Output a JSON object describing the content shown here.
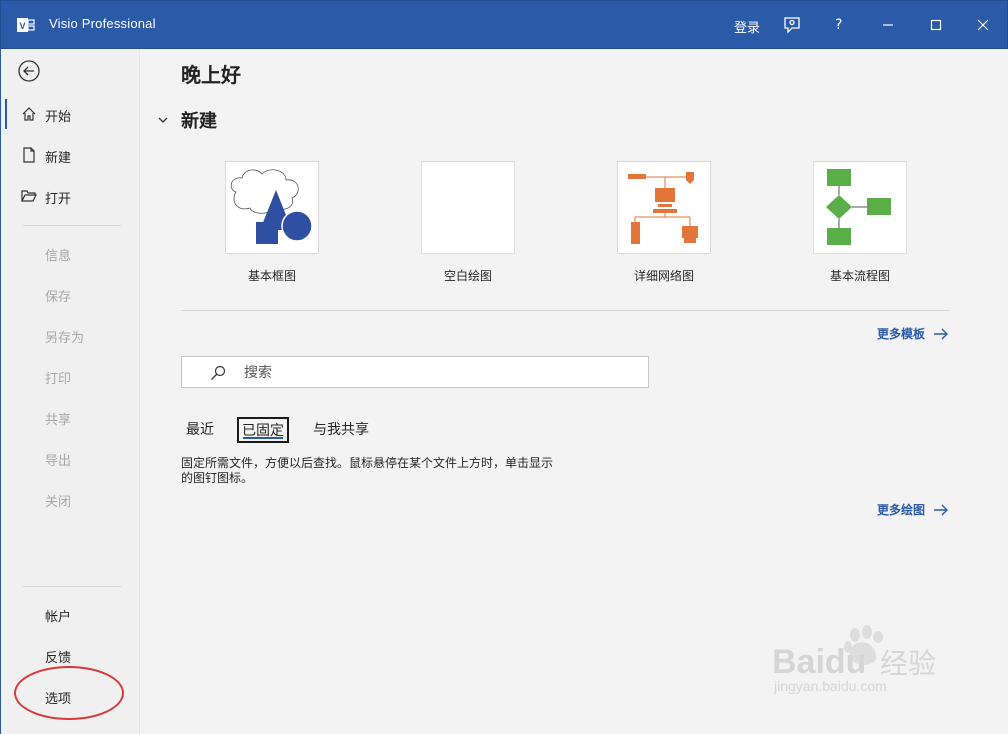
{
  "titlebar": {
    "app_title": "Visio Professional",
    "sign_in": "登录",
    "help": "?",
    "colors": {
      "bar": "#2b5aa8"
    }
  },
  "sidebar": {
    "top_items": [
      {
        "label": "开始",
        "icon": "home-icon"
      },
      {
        "label": "新建",
        "icon": "new-file-icon"
      },
      {
        "label": "打开",
        "icon": "open-folder-icon"
      }
    ],
    "disabled_items": [
      "信息",
      "保存",
      "另存为",
      "打印",
      "共享",
      "导出",
      "关闭"
    ],
    "bottom_items": [
      "帐户",
      "反馈",
      "选项"
    ]
  },
  "main": {
    "greeting": "晚上好",
    "new_section_title": "新建",
    "templates": [
      {
        "name": "基本框图"
      },
      {
        "name": "空白绘图"
      },
      {
        "name": "详细网络图"
      },
      {
        "name": "基本流程图"
      }
    ],
    "more_templates": "更多模板",
    "search_placeholder": "搜索",
    "tabs": [
      "最近",
      "已固定",
      "与我共享"
    ],
    "active_tab": "已固定",
    "pinned_hint": "固定所需文件，方便以后查找。鼠标悬停在某个文件上方时，单击显示的图钉图标。",
    "more_drawings": "更多绘图"
  },
  "watermark": {
    "brand": "Baidu经验",
    "url": "jingyan.baidu.com"
  }
}
